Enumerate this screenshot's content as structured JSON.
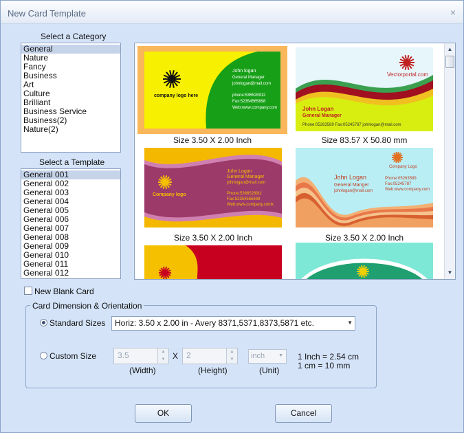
{
  "window": {
    "title": "New Card Template",
    "close_icon": "×"
  },
  "category": {
    "heading": "Select a Category",
    "items": [
      "General",
      "Nature",
      "Fancy",
      "Business",
      "Art",
      "Culture",
      "Brilliant",
      "Business Service",
      "Business(2)",
      "Nature(2)"
    ],
    "selected_index": 0
  },
  "template": {
    "heading": "Select a Template",
    "items": [
      "General 001",
      "General 002",
      "General 003",
      "General 004",
      "General 005",
      "General 006",
      "General 007",
      "General 008",
      "General 009",
      "General 010",
      "General 011",
      "General 012"
    ],
    "selected_index": 0
  },
  "cards": [
    {
      "size": "Size 3.50 X 2.00 Inch",
      "logo_text": "company logo here",
      "lines": [
        "John logan",
        "General Manager",
        "johnlogan@mail.com",
        "phone:536528912",
        "Fax:52354565898",
        "Web:www.company.com"
      ],
      "colors": {
        "bg": "#f7f000",
        "band": "#17a017",
        "accent": "#111111"
      }
    },
    {
      "size": "Size 83.57 X 50.80 mm",
      "logo_text": "Vectorportal.com",
      "lines": [
        "John Logan",
        "General Manager",
        "Phone:05263589  Fax:05245787  johnlogan@mail.com"
      ],
      "colors": {
        "bg": "#d8ee10",
        "band": "#a01020",
        "accent": "#c02020"
      }
    },
    {
      "size": "Size 3.50 X 2.00 Inch",
      "logo_text": "Company logo",
      "lines": [
        "John Logan",
        "General Manager",
        "johnlogan@mail.com",
        "Phone:53665289I2",
        "Fax:52354565898",
        "Web:www.company.comk"
      ],
      "colors": {
        "bg": "#9c3a6a",
        "band": "#f5b800",
        "accent": "#f5c000"
      }
    },
    {
      "size": "Size 3.50 X 2.00 Inch",
      "logo_text": "Company Logo",
      "lines": [
        "John Logan",
        "General Manger",
        "johnlogan@mail.com",
        "Phone:05263589",
        "Fax:05245787",
        "Web:www.company.com"
      ],
      "colors": {
        "bg": "#b9eef5",
        "band": "#e8784a",
        "accent": "#c84a20"
      }
    }
  ],
  "new_blank_card": {
    "label": "New Blank Card",
    "checked": false
  },
  "dimension_group": {
    "title": "Card Dimension & Orientation",
    "standard_label": "Standard Sizes",
    "standard_selected": true,
    "standard_value": "Horiz: 3.50 x 2.00 in - Avery 8371,5371,8373,5871 etc.",
    "custom_label": "Custom Size",
    "width_value": "3.5",
    "height_value": "2",
    "times_label": "X",
    "unit_value": "inch",
    "width_caption": "(Width)",
    "height_caption": "(Height)",
    "unit_caption": "(Unit)",
    "note_inch": "1 Inch = 2.54 cm",
    "note_cm": "1 cm = 10 mm"
  },
  "buttons": {
    "ok": "OK",
    "cancel": "Cancel"
  }
}
